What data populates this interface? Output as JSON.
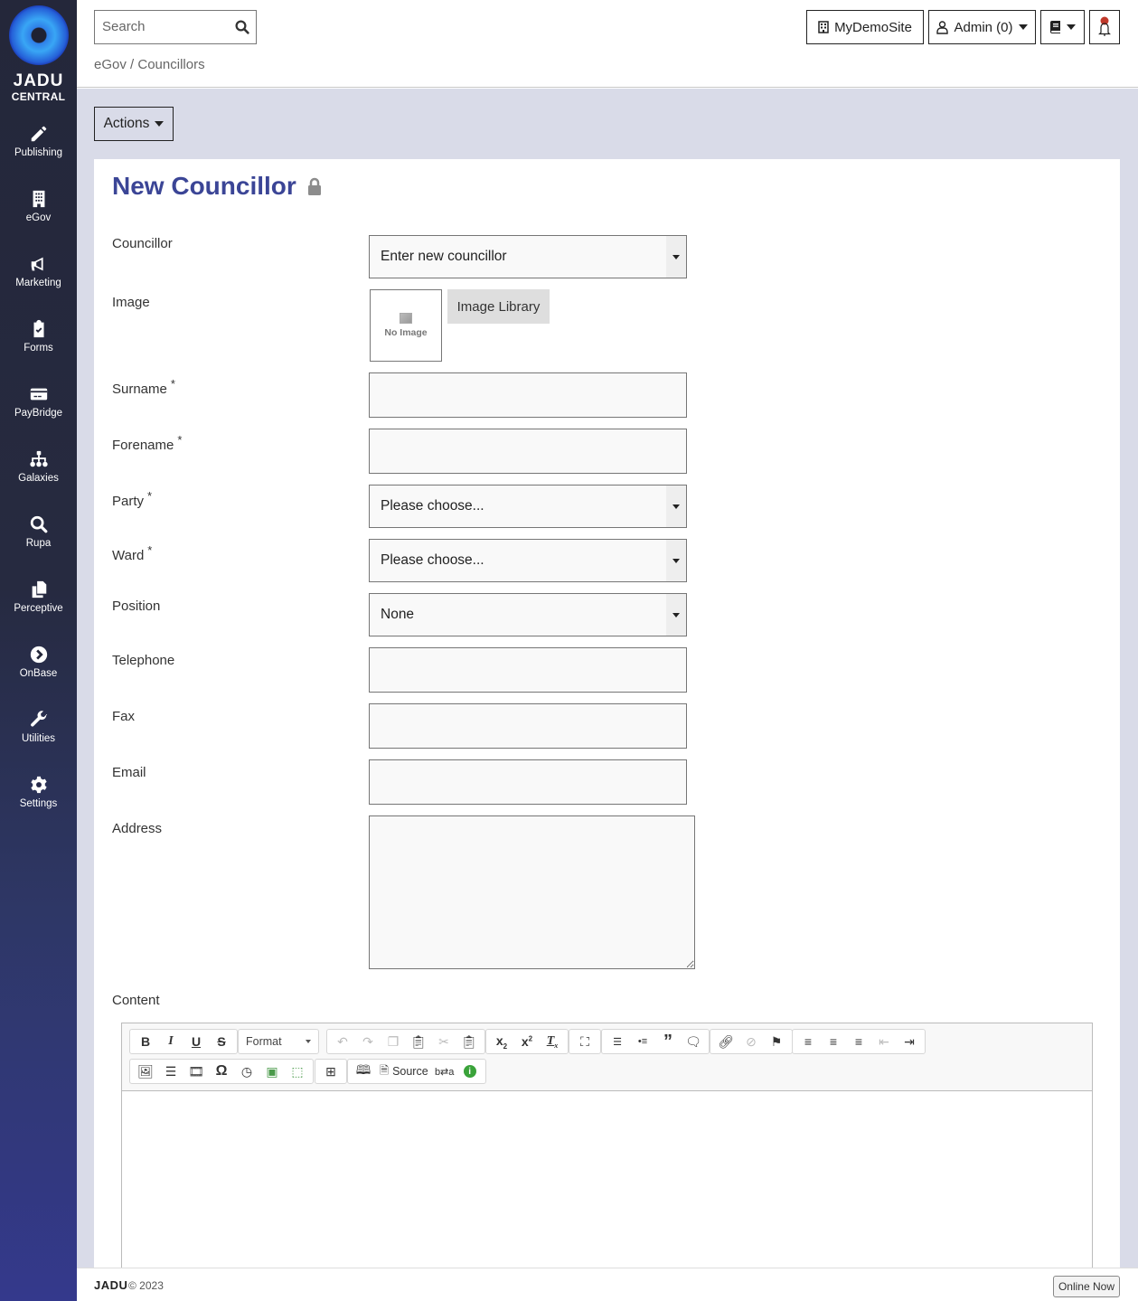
{
  "logo": {
    "line1": "JADU",
    "line2": "CENTRAL"
  },
  "sidebar": {
    "items": [
      {
        "label": "Publishing",
        "icon": "pencil-icon"
      },
      {
        "label": "eGov",
        "icon": "building-icon"
      },
      {
        "label": "Marketing",
        "icon": "megaphone-icon"
      },
      {
        "label": "Forms",
        "icon": "clipboard-check-icon"
      },
      {
        "label": "PayBridge",
        "icon": "credit-card-icon"
      },
      {
        "label": "Galaxies",
        "icon": "sitemap-icon"
      },
      {
        "label": "Rupa",
        "icon": "search-icon"
      },
      {
        "label": "Perceptive",
        "icon": "copy-icon"
      },
      {
        "label": "OnBase",
        "icon": "chevron-circle-right-icon"
      },
      {
        "label": "Utilities",
        "icon": "wrench-icon"
      },
      {
        "label": "Settings",
        "icon": "gear-icon"
      }
    ]
  },
  "header": {
    "search_placeholder": "Search",
    "breadcrumb": {
      "parent": "eGov",
      "separator": " / ",
      "current": "Councillors"
    },
    "site_button": "MyDemoSite",
    "user_button": "Admin (0)",
    "notification_dot_color": "#c0392b"
  },
  "main": {
    "actions_label": "Actions",
    "page_title": "New Councillor",
    "form": {
      "councillor": {
        "label": "Councillor",
        "value": "Enter new councillor"
      },
      "image": {
        "label": "Image",
        "placeholder": "No Image",
        "library_button": "Image Library"
      },
      "surname": {
        "label": "Surname",
        "required": "*",
        "value": ""
      },
      "forename": {
        "label": "Forename",
        "required": "*",
        "value": ""
      },
      "party": {
        "label": "Party",
        "required": "*",
        "value": "Please choose..."
      },
      "ward": {
        "label": "Ward",
        "required": "*",
        "value": "Please choose..."
      },
      "position": {
        "label": "Position",
        "value": "None"
      },
      "telephone": {
        "label": "Telephone",
        "value": ""
      },
      "fax": {
        "label": "Fax",
        "value": ""
      },
      "email": {
        "label": "Email",
        "value": ""
      },
      "address": {
        "label": "Address",
        "value": ""
      },
      "content": {
        "label": "Content"
      }
    },
    "editor": {
      "format_label": "Format",
      "source_label": "Source"
    }
  },
  "footer": {
    "brand": "JADU",
    "copyright": "© 2023",
    "online_button": "Online Now"
  },
  "colors": {
    "title": "#3b4596",
    "main_bg": "#d9dbe8",
    "sidebar_top": "#24273a",
    "sidebar_bottom": "#34398c"
  }
}
